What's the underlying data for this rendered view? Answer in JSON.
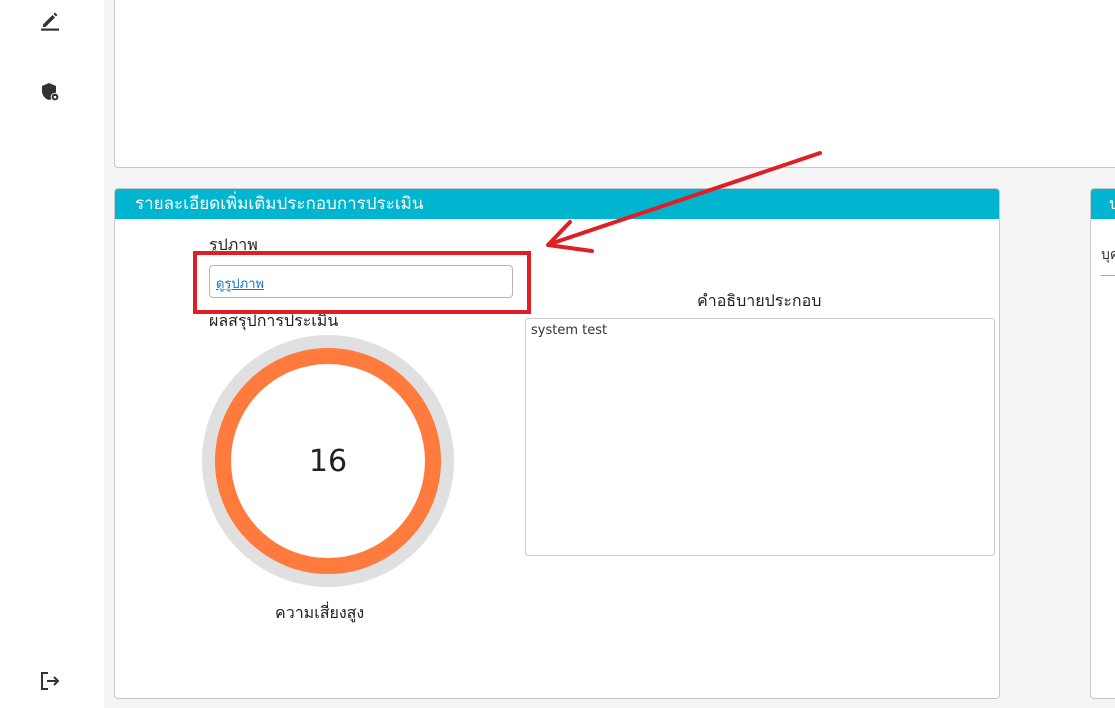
{
  "sidebar": {
    "icons": [
      {
        "name": "edit-icon"
      },
      {
        "name": "shield-icon"
      },
      {
        "name": "logout-icon"
      }
    ]
  },
  "card": {
    "title": "รายละเอียดเพิ่มเติมประกอบการประเมิน",
    "image_label": "รูปภาพ",
    "image_link": "ดูรูปภาพ",
    "summary_label": "ผลสรุปการประเมิน",
    "score": "16",
    "risk_label": "ความเสี่ยงสูง",
    "description_label": "คำอธิบายประกอบ",
    "description_text": "system test"
  },
  "right_card": {
    "title": "ป",
    "text": "บุค"
  },
  "colors": {
    "header": "#00b5cf",
    "gauge": "#ff7a3d",
    "gauge_track": "#e0e0e0",
    "annotation": "#e01e25",
    "link": "#1a73c9"
  }
}
